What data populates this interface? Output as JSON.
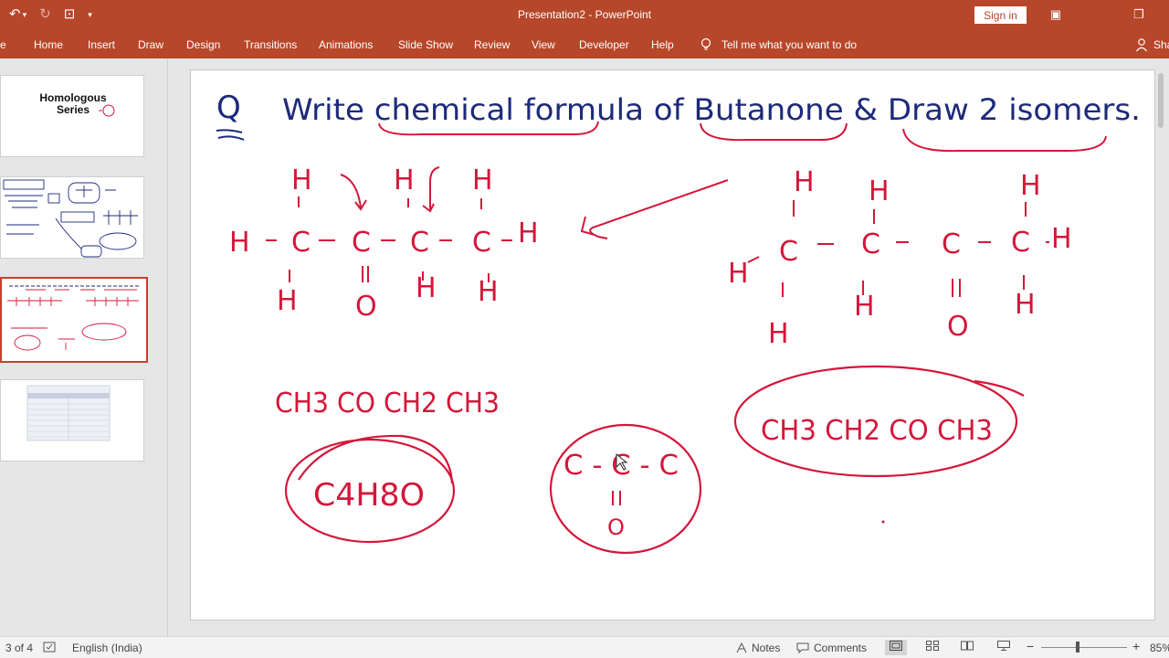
{
  "app": {
    "title": "Presentation2  -  PowerPoint",
    "signin_label": "Sign in"
  },
  "qat": {
    "undo_icon": "↶",
    "undo_arrow": "▾",
    "redo_icon": "↻",
    "present_icon": "⊡",
    "customize_icon": "▾"
  },
  "window": {
    "ribbon_display_icon": "▣",
    "restore_icon": "❐"
  },
  "tabs": [
    {
      "label": "e"
    },
    {
      "label": "Home"
    },
    {
      "label": "Insert"
    },
    {
      "label": "Draw"
    },
    {
      "label": "Design"
    },
    {
      "label": "Transitions"
    },
    {
      "label": "Animations"
    },
    {
      "label": "Slide Show"
    },
    {
      "label": "Review"
    },
    {
      "label": "View"
    },
    {
      "label": "Developer"
    },
    {
      "label": "Help"
    }
  ],
  "tell_me": "Tell me what you want to do",
  "share_label": "Sha",
  "thumbnails": {
    "slide1_title_line1": "Homologous",
    "slide1_title_line2": "Series"
  },
  "slide": {
    "question_mark": "Q",
    "heading": "Write chemical formula of Butanone & Draw 2 isomers.",
    "struct1": {
      "row_top": [
        "H",
        "H",
        "H"
      ],
      "row_mid": [
        "H",
        "C",
        "C",
        "C",
        "C",
        "H"
      ],
      "row_bottom": [
        "H",
        "H",
        "H"
      ],
      "carbonyl_o": "O"
    },
    "struct2": {
      "row_top": [
        "H",
        "H",
        "H"
      ],
      "row_mid": [
        "H",
        "C",
        "C",
        "C",
        "C",
        "H"
      ],
      "row_bottom": [
        "H",
        "H",
        "H"
      ],
      "carbonyl_o": "O"
    },
    "formula_condensed": "CH3 CO CH2 CH3",
    "formula_molecular": "C4H8O",
    "formula_skeleton_chain": "C - C - C",
    "formula_skeleton_o": "O",
    "formula_isomer": "CH3 CH2 CO CH3"
  },
  "status": {
    "slide_counter": "3 of 4",
    "language": "English (India)",
    "notes_label": "Notes",
    "comments_label": "Comments",
    "zoom_minus": "−",
    "zoom_plus": "+",
    "zoom_level": "85%"
  },
  "colors": {
    "ribbon": "#b7472a",
    "ink_red": "#d4173a",
    "ink_navy": "#1d2a7a"
  }
}
